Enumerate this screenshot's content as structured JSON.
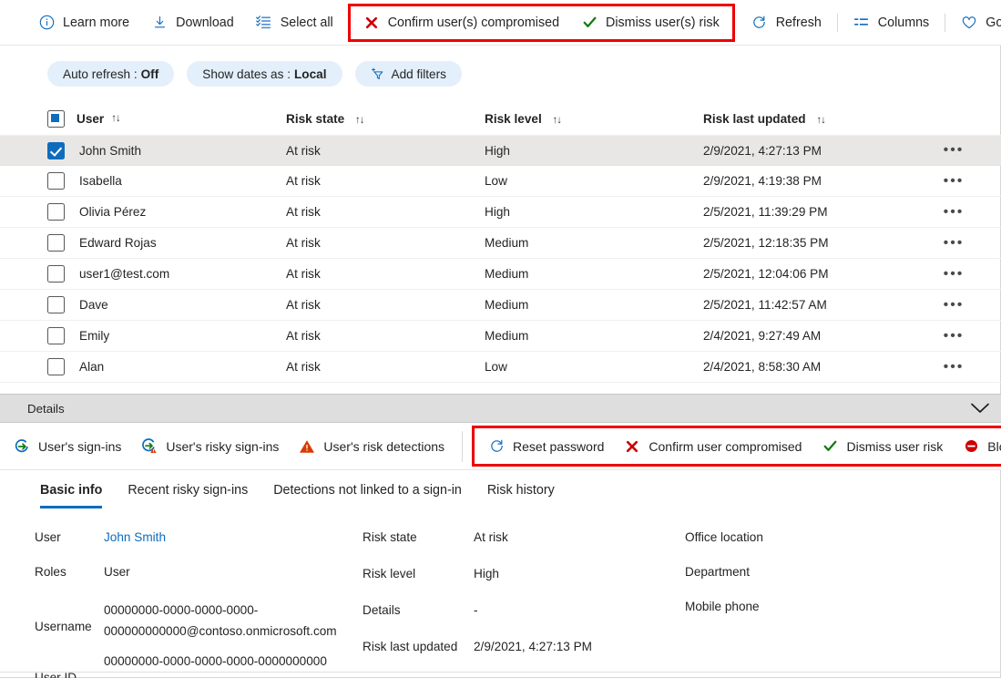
{
  "colors": {
    "accent": "#0f6cbd",
    "highlight_box": "#ed0000",
    "danger": "#cc0000",
    "success": "#107c10",
    "warning": "#d83b01",
    "pill_bg": "#e3effa",
    "selected_row": "#e9e7e5",
    "details_bar": "#dedede"
  },
  "command_bar": {
    "items": [
      {
        "label": "Learn more",
        "icon": "info-icon"
      },
      {
        "label": "Download",
        "icon": "download-icon"
      },
      {
        "label": "Select all",
        "icon": "select-all-icon"
      },
      {
        "label": "Confirm user(s) compromised",
        "icon": "red-x-icon",
        "highlighted": true
      },
      {
        "label": "Dismiss user(s) risk",
        "icon": "green-check-icon",
        "highlighted": true
      },
      {
        "label": "Refresh",
        "icon": "refresh-icon"
      },
      {
        "label": "Columns",
        "icon": "columns-icon"
      },
      {
        "label": "Got feedback?",
        "icon": "heart-icon"
      }
    ]
  },
  "filters": {
    "auto_refresh": {
      "label": "Auto refresh :",
      "value": "Off"
    },
    "show_dates_as": {
      "label": "Show dates as :",
      "value": "Local"
    },
    "add_filters": {
      "label": "Add filters",
      "icon": "add-filter-icon"
    }
  },
  "table": {
    "columns": [
      {
        "key": "user",
        "label": "User",
        "sortable": true
      },
      {
        "key": "risk_state",
        "label": "Risk state",
        "sortable": true
      },
      {
        "key": "risk_level",
        "label": "Risk level",
        "sortable": true
      },
      {
        "key": "risk_last_updated",
        "label": "Risk last updated",
        "sortable": true
      }
    ],
    "sort_icon": "↑↓",
    "row_menu_icon": "•••",
    "rows": [
      {
        "user": "John Smith",
        "risk_state": "At risk",
        "risk_level": "High",
        "risk_last_updated": "2/9/2021, 4:27:13 PM",
        "selected": true
      },
      {
        "user": "Isabella",
        "risk_state": "At risk",
        "risk_level": "Low",
        "risk_last_updated": "2/9/2021, 4:19:38 PM",
        "selected": false
      },
      {
        "user": "Olivia Pérez",
        "risk_state": "At risk",
        "risk_level": "High",
        "risk_last_updated": "2/5/2021, 11:39:29 PM",
        "selected": false
      },
      {
        "user": "Edward Rojas",
        "risk_state": "At risk",
        "risk_level": "Medium",
        "risk_last_updated": "2/5/2021, 12:18:35 PM",
        "selected": false
      },
      {
        "user": "user1@test.com",
        "risk_state": "At risk",
        "risk_level": "Medium",
        "risk_last_updated": "2/5/2021, 12:04:06 PM",
        "selected": false
      },
      {
        "user": "Dave",
        "risk_state": "At risk",
        "risk_level": "Medium",
        "risk_last_updated": "2/5/2021, 11:42:57 AM",
        "selected": false
      },
      {
        "user": "Emily",
        "risk_state": "At risk",
        "risk_level": "Medium",
        "risk_last_updated": "2/4/2021, 9:27:49 AM",
        "selected": false
      },
      {
        "user": "Alan",
        "risk_state": "At risk",
        "risk_level": "Low",
        "risk_last_updated": "2/4/2021, 8:58:30 AM",
        "selected": false
      }
    ]
  },
  "details_bar": {
    "title": "Details",
    "collapse_icon": "chevron-down-icon"
  },
  "detail_actions": {
    "items": [
      {
        "label": "User's sign-ins",
        "icon": "signin-arrow-icon",
        "highlighted": false
      },
      {
        "label": "User's risky sign-ins",
        "icon": "risky-signin-icon",
        "highlighted": false
      },
      {
        "label": "User's risk detections",
        "icon": "warning-triangle-icon",
        "highlighted": false
      },
      {
        "label": "Reset password",
        "icon": "refresh-icon",
        "highlighted": true
      },
      {
        "label": "Confirm user compromised",
        "icon": "red-x-icon",
        "highlighted": true
      },
      {
        "label": "Dismiss user risk",
        "icon": "green-check-icon",
        "highlighted": true
      },
      {
        "label": "Block user",
        "icon": "block-icon",
        "highlighted": true
      }
    ]
  },
  "tabs": [
    {
      "label": "Basic info",
      "active": true
    },
    {
      "label": "Recent risky sign-ins",
      "active": false
    },
    {
      "label": "Detections not linked to a sign-in",
      "active": false
    },
    {
      "label": "Risk history",
      "active": false
    }
  ],
  "basic_info": {
    "column_1": [
      {
        "label": "User",
        "value": "John Smith",
        "is_link": true
      },
      {
        "label": "Roles",
        "value": "User",
        "is_link": false
      },
      {
        "label": "Username",
        "value": "00000000-0000-0000-0000-000000000000@contoso.onmicrosoft.com",
        "is_link": false
      },
      {
        "label": "User ID",
        "value": "00000000-0000-0000-0000-0000000000",
        "is_link": false
      }
    ],
    "column_2": [
      {
        "label": "Risk state",
        "value": "At risk"
      },
      {
        "label": "Risk level",
        "value": "High"
      },
      {
        "label": "Details",
        "value": "-"
      },
      {
        "label": "Risk last updated",
        "value": "2/9/2021, 4:27:13 PM"
      }
    ],
    "column_3": [
      {
        "label": "Office location",
        "value": ""
      },
      {
        "label": "Department",
        "value": ""
      },
      {
        "label": "Mobile phone",
        "value": ""
      }
    ]
  }
}
